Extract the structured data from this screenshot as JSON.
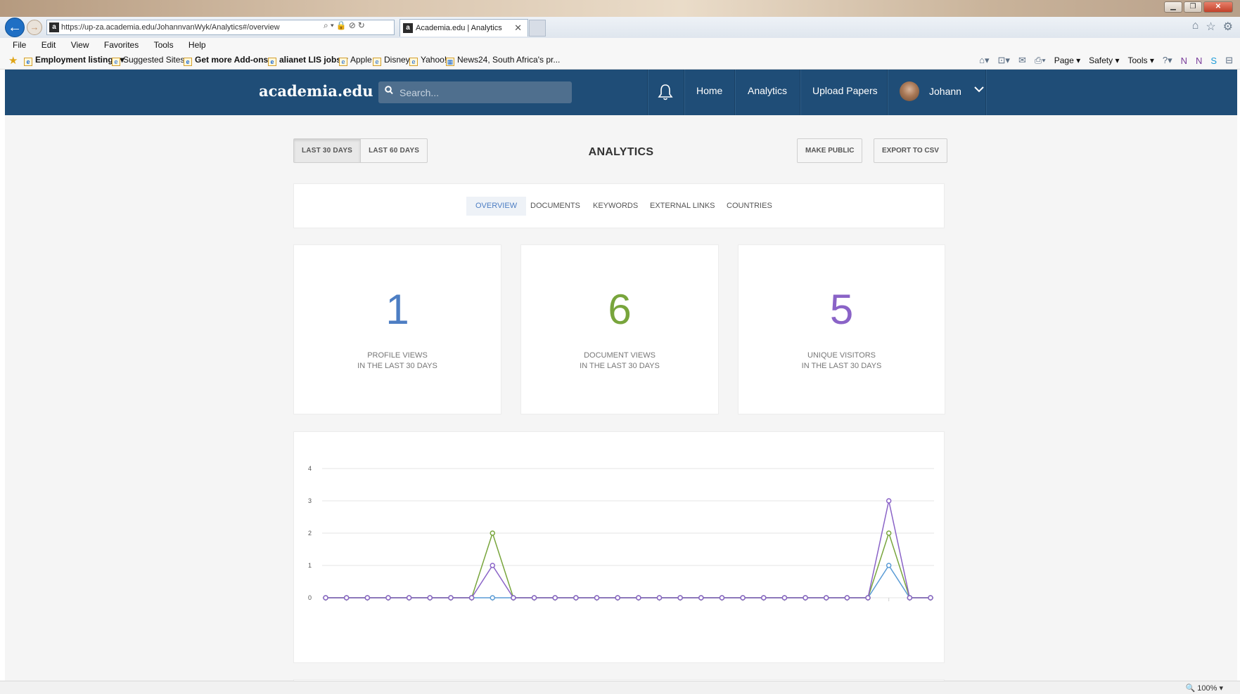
{
  "browser": {
    "url": "https://up-za.academia.edu/JohannvanWyk/Analytics#/overview",
    "tab_title": "Academia.edu | Analytics",
    "menu": [
      "File",
      "Edit",
      "View",
      "Favorites",
      "Tools",
      "Help"
    ],
    "favorites": [
      {
        "label": "Employment listings ▾",
        "bold": true
      },
      {
        "label": "Suggested Sites ▾",
        "bold": false
      },
      {
        "label": "Get more Add-ons ▾",
        "bold": true
      },
      {
        "label": "alianet LIS jobs ▾",
        "bold": true
      },
      {
        "label": "Apple",
        "bold": false
      },
      {
        "label": "Disney",
        "bold": false
      },
      {
        "label": "Yahoo!",
        "bold": false
      },
      {
        "label": "News24, South Africa's pr...",
        "bold": false
      }
    ],
    "command_bar": [
      "Page ▾",
      "Safety ▾",
      "Tools ▾"
    ],
    "zoom": "100%"
  },
  "site": {
    "logo": "academia.edu",
    "search_placeholder": "Search...",
    "nav": {
      "home": "Home",
      "analytics": "Analytics",
      "upload": "Upload Papers"
    },
    "user_name": "Johann"
  },
  "controls": {
    "range_30": "LAST 30 DAYS",
    "range_60": "LAST 60 DAYS",
    "title": "ANALYTICS",
    "make_public": "MAKE PUBLIC",
    "export_csv": "EXPORT TO CSV"
  },
  "tabs": [
    "OVERVIEW",
    "DOCUMENTS",
    "KEYWORDS",
    "EXTERNAL LINKS",
    "COUNTRIES"
  ],
  "stats": [
    {
      "value": "1",
      "line1": "PROFILE VIEWS",
      "line2": "IN THE LAST 30 DAYS",
      "color": "#4d7ec3"
    },
    {
      "value": "6",
      "line1": "DOCUMENT VIEWS",
      "line2": "IN THE LAST 30 DAYS",
      "color": "#78a53c"
    },
    {
      "value": "5",
      "line1": "UNIQUE VISITORS",
      "line2": "IN THE LAST 30 DAYS",
      "color": "#8a63c7"
    }
  ],
  "chart_data": {
    "type": "line",
    "x": [
      1,
      2,
      3,
      4,
      5,
      6,
      7,
      8,
      9,
      10,
      11,
      12,
      13,
      14,
      15,
      16,
      17,
      18,
      19,
      20,
      21,
      22,
      23,
      24,
      25,
      26,
      27,
      28,
      29,
      30
    ],
    "ylim": [
      0,
      4
    ],
    "yticks": [
      "0",
      "1",
      "2",
      "3",
      "4"
    ],
    "grid": true,
    "series": [
      {
        "color": "#5a9bd5",
        "values": [
          0,
          0,
          0,
          0,
          0,
          0,
          0,
          0,
          0,
          0,
          0,
          0,
          0,
          0,
          0,
          0,
          0,
          0,
          0,
          0,
          0,
          0,
          0,
          0,
          0,
          0,
          0,
          1,
          0,
          0
        ]
      },
      {
        "color": "#78a53c",
        "values": [
          0,
          0,
          0,
          0,
          0,
          0,
          0,
          0,
          2,
          0,
          0,
          0,
          0,
          0,
          0,
          0,
          0,
          0,
          0,
          0,
          0,
          0,
          0,
          0,
          0,
          0,
          0,
          2,
          0,
          0
        ]
      },
      {
        "color": "#8a63c7",
        "values": [
          0,
          0,
          0,
          0,
          0,
          0,
          0,
          0,
          1,
          0,
          0,
          0,
          0,
          0,
          0,
          0,
          0,
          0,
          0,
          0,
          0,
          0,
          0,
          0,
          0,
          0,
          0,
          3,
          0,
          0
        ]
      }
    ]
  }
}
